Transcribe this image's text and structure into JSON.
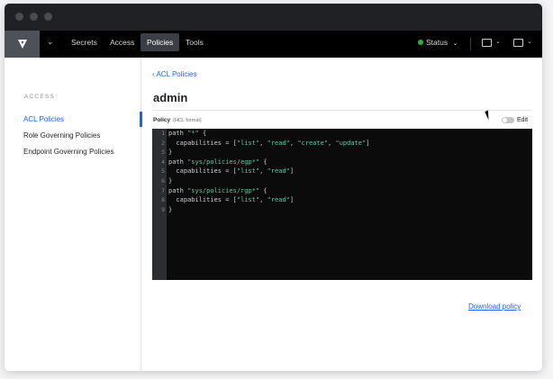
{
  "nav": {
    "items": [
      {
        "label": "Secrets",
        "active": false
      },
      {
        "label": "Access",
        "active": false
      },
      {
        "label": "Policies",
        "active": true
      },
      {
        "label": "Tools",
        "active": false
      }
    ],
    "status_label": "Status",
    "status_color": "#2eb039",
    "icons": [
      "vault-logo-icon",
      "chevron-down-icon",
      "terminal-icon",
      "user-icon"
    ]
  },
  "sidebar": {
    "heading": "ACCESS",
    "items": [
      {
        "label": "ACL Policies",
        "active": true
      },
      {
        "label": "Role Governing Policies",
        "active": false
      },
      {
        "label": "Endpoint Governing Policies",
        "active": false
      }
    ]
  },
  "main": {
    "breadcrumb": "ACL Policies",
    "title": "admin",
    "policy_label": "Policy",
    "policy_format": "(HCL format)",
    "edit_label": "Edit",
    "edit_enabled": false,
    "download_label": "Download policy"
  },
  "editor": {
    "line_numbers": [
      "1",
      "2",
      "3",
      "4",
      "5",
      "6",
      "7",
      "8",
      "9"
    ],
    "lines": [
      "path \"*\" {",
      "  capabilities = [\"list\", \"read\", \"create\", \"update\"]",
      "}",
      "path \"sys/policies/egp*\" {",
      "  capabilities = [\"list\", \"read\"]",
      "}",
      "path \"sys/policies/rgp*\" {",
      "  capabilities = [\"list\", \"read\"]",
      "}"
    ]
  },
  "colors": {
    "accent": "#1563ff",
    "nav_bg": "#000000",
    "editor_bg": "#0b0b0c",
    "string": "#5fc8a6"
  }
}
